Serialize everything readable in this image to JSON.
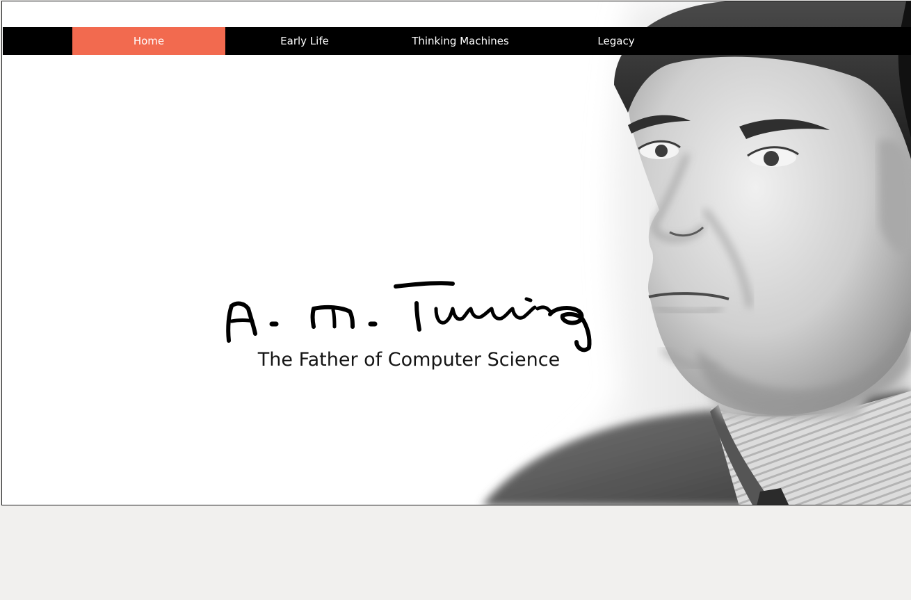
{
  "nav": {
    "items": [
      {
        "label": "Home",
        "active": true
      },
      {
        "label": "Early Life",
        "active": false
      },
      {
        "label": "Thinking Machines",
        "active": false
      },
      {
        "label": "Legacy",
        "active": false
      }
    ]
  },
  "hero": {
    "signature_text": "A. M. Turing",
    "tagline": "The Father of Computer Science",
    "portrait_icon": "portrait-photo"
  },
  "colors": {
    "nav_background": "#000000",
    "nav_active": "#f26a4f",
    "nav_text": "#ffffff",
    "page_background": "#f1f0ee",
    "hero_background": "#ffffff"
  }
}
